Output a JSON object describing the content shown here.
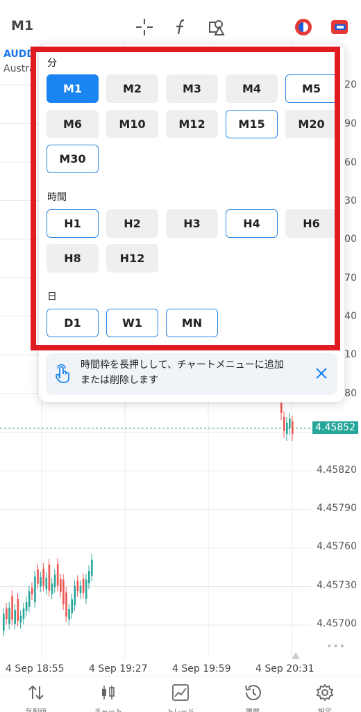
{
  "topbar": {
    "timeframe": "M1",
    "icons": [
      "crosshair-icon",
      "function-icon",
      "objects-icon",
      "account-icon",
      "trade-toggle-icon"
    ]
  },
  "chart": {
    "symbol": "AUDD",
    "symbol_desc": "Austra",
    "price_labels": [
      "20",
      "90",
      "60",
      "30",
      "00",
      "70",
      "40",
      "10",
      "80",
      "4.45820",
      "4.45790",
      "4.45760",
      "4.45730",
      "4.45700"
    ],
    "current_price": "4.45852",
    "time_labels": [
      "4 Sep 18:55",
      "4 Sep 19:27",
      "4 Sep 19:59",
      "4 Sep 20:31"
    ],
    "colors": {
      "up": "#26a69a",
      "down": "#ef5350",
      "grid": "#e8e8e8"
    }
  },
  "popup": {
    "sections": [
      {
        "title": "分",
        "buttons": [
          "M1",
          "M2",
          "M3",
          "M4",
          "M5",
          "M6",
          "M10",
          "M12",
          "M15",
          "M20",
          "M30"
        ]
      },
      {
        "title": "時間",
        "buttons": [
          "H1",
          "H2",
          "H3",
          "H4",
          "H6",
          "H8",
          "H12"
        ]
      },
      {
        "title": "日",
        "buttons": [
          "D1",
          "W1",
          "MN"
        ]
      }
    ],
    "active": "M1",
    "selected": [
      "M5",
      "M15",
      "M30",
      "H1",
      "H4",
      "D1",
      "W1",
      "MN"
    ],
    "hint": {
      "line1": "時間枠を長押しして、チャートメニューに追加",
      "line2": "または削除します"
    },
    "accent_color": "#1a84f0",
    "highlight_color": "#e11b22"
  },
  "bottomnav": {
    "items": [
      {
        "label": "気配値",
        "icon": "quotes-icon"
      },
      {
        "label": "チャート",
        "icon": "chart-icon"
      },
      {
        "label": "トレード",
        "icon": "trade-icon"
      },
      {
        "label": "履歴",
        "icon": "history-icon"
      },
      {
        "label": "設定",
        "icon": "settings-icon"
      }
    ]
  }
}
